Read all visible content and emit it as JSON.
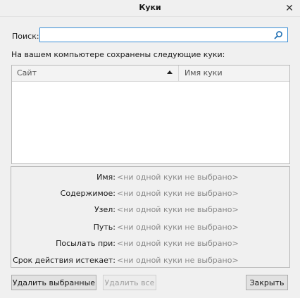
{
  "window": {
    "title": "Куки",
    "close_glyph": "✕"
  },
  "search": {
    "label": "Поиск:",
    "value": "",
    "placeholder": "",
    "icon": "search-icon"
  },
  "description": "На вашем компьютере сохранены следующие куки:",
  "table": {
    "columns": [
      {
        "label": "Сайт",
        "sort": "ascending"
      },
      {
        "label": "Имя куки"
      }
    ],
    "rows": []
  },
  "details": [
    {
      "label": "Имя:",
      "value": "<ни одной куки не выбрано>"
    },
    {
      "label": "Содержимое:",
      "value": "<ни одной куки не выбрано>"
    },
    {
      "label": "Узел:",
      "value": "<ни одной куки не выбрано>"
    },
    {
      "label": "Путь:",
      "value": "<ни одной куки не выбрано>"
    },
    {
      "label": "Посылать при:",
      "value": "<ни одной куки не выбрано>"
    },
    {
      "label": "Срок действия истекает:",
      "value": "<ни одной куки не выбрано>"
    }
  ],
  "buttons": {
    "remove_selected": "Удалить выбранные",
    "remove_all": "Удалить все",
    "close": "Закрыть"
  },
  "colors": {
    "accent": "#3b8fd6",
    "background": "#f0f0f0",
    "muted_text": "#8a8a8a"
  }
}
